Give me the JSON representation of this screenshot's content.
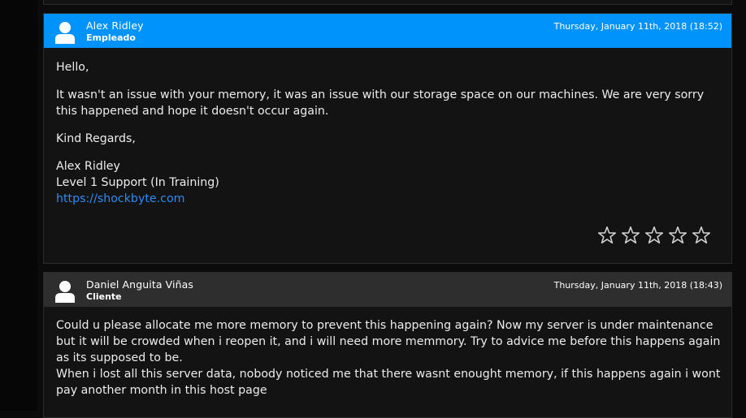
{
  "replies": [
    {
      "author": "Alex Ridley",
      "role": "Empleado",
      "date": "Thursday, January 11th, 2018 (18:52)",
      "greeting": "Hello,",
      "body": "It wasn't an issue with your memory, it was an issue with our storage space on our machines. We are very sorry this happened and hope it doesn't occur again.",
      "closing": "Kind Regards,",
      "signature_name": "Alex Ridley",
      "signature_title": "Level 1 Support (In Training)",
      "signature_link": "https://shockbyte.com",
      "rating_stars": 5,
      "header_color": "#0093fb"
    },
    {
      "author": "Daniel Anguita Viñas",
      "role": "Cliente",
      "date": "Thursday, January 11th, 2018 (18:43)",
      "line1": "Could u please allocate me more memory to prevent this happening again? Now my server is under maintenance but it will be crowded when i reopen it, and i will need more memmory. Try to advice me before this happens again as its supposed to be.",
      "line2": "When i lost all this server data, nobody noticed me that there wasnt enought memory, if this happens again i wont pay another month in this host page",
      "header_color": "#2e2e2e"
    }
  ],
  "icons": {
    "avatar": "user-silhouette-icon",
    "rating": "star-outline-icon"
  }
}
